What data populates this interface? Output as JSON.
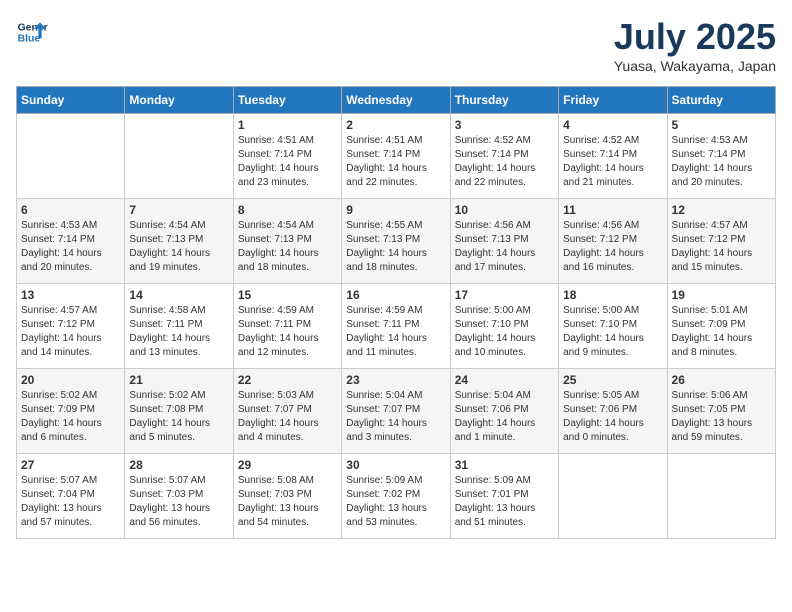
{
  "header": {
    "logo_line1": "General",
    "logo_line2": "Blue",
    "month": "July 2025",
    "location": "Yuasa, Wakayama, Japan"
  },
  "days_of_week": [
    "Sunday",
    "Monday",
    "Tuesday",
    "Wednesday",
    "Thursday",
    "Friday",
    "Saturday"
  ],
  "weeks": [
    [
      {
        "day": "",
        "detail": ""
      },
      {
        "day": "",
        "detail": ""
      },
      {
        "day": "1",
        "detail": "Sunrise: 4:51 AM\nSunset: 7:14 PM\nDaylight: 14 hours\nand 23 minutes."
      },
      {
        "day": "2",
        "detail": "Sunrise: 4:51 AM\nSunset: 7:14 PM\nDaylight: 14 hours\nand 22 minutes."
      },
      {
        "day": "3",
        "detail": "Sunrise: 4:52 AM\nSunset: 7:14 PM\nDaylight: 14 hours\nand 22 minutes."
      },
      {
        "day": "4",
        "detail": "Sunrise: 4:52 AM\nSunset: 7:14 PM\nDaylight: 14 hours\nand 21 minutes."
      },
      {
        "day": "5",
        "detail": "Sunrise: 4:53 AM\nSunset: 7:14 PM\nDaylight: 14 hours\nand 20 minutes."
      }
    ],
    [
      {
        "day": "6",
        "detail": "Sunrise: 4:53 AM\nSunset: 7:14 PM\nDaylight: 14 hours\nand 20 minutes."
      },
      {
        "day": "7",
        "detail": "Sunrise: 4:54 AM\nSunset: 7:13 PM\nDaylight: 14 hours\nand 19 minutes."
      },
      {
        "day": "8",
        "detail": "Sunrise: 4:54 AM\nSunset: 7:13 PM\nDaylight: 14 hours\nand 18 minutes."
      },
      {
        "day": "9",
        "detail": "Sunrise: 4:55 AM\nSunset: 7:13 PM\nDaylight: 14 hours\nand 18 minutes."
      },
      {
        "day": "10",
        "detail": "Sunrise: 4:56 AM\nSunset: 7:13 PM\nDaylight: 14 hours\nand 17 minutes."
      },
      {
        "day": "11",
        "detail": "Sunrise: 4:56 AM\nSunset: 7:12 PM\nDaylight: 14 hours\nand 16 minutes."
      },
      {
        "day": "12",
        "detail": "Sunrise: 4:57 AM\nSunset: 7:12 PM\nDaylight: 14 hours\nand 15 minutes."
      }
    ],
    [
      {
        "day": "13",
        "detail": "Sunrise: 4:57 AM\nSunset: 7:12 PM\nDaylight: 14 hours\nand 14 minutes."
      },
      {
        "day": "14",
        "detail": "Sunrise: 4:58 AM\nSunset: 7:11 PM\nDaylight: 14 hours\nand 13 minutes."
      },
      {
        "day": "15",
        "detail": "Sunrise: 4:59 AM\nSunset: 7:11 PM\nDaylight: 14 hours\nand 12 minutes."
      },
      {
        "day": "16",
        "detail": "Sunrise: 4:59 AM\nSunset: 7:11 PM\nDaylight: 14 hours\nand 11 minutes."
      },
      {
        "day": "17",
        "detail": "Sunrise: 5:00 AM\nSunset: 7:10 PM\nDaylight: 14 hours\nand 10 minutes."
      },
      {
        "day": "18",
        "detail": "Sunrise: 5:00 AM\nSunset: 7:10 PM\nDaylight: 14 hours\nand 9 minutes."
      },
      {
        "day": "19",
        "detail": "Sunrise: 5:01 AM\nSunset: 7:09 PM\nDaylight: 14 hours\nand 8 minutes."
      }
    ],
    [
      {
        "day": "20",
        "detail": "Sunrise: 5:02 AM\nSunset: 7:09 PM\nDaylight: 14 hours\nand 6 minutes."
      },
      {
        "day": "21",
        "detail": "Sunrise: 5:02 AM\nSunset: 7:08 PM\nDaylight: 14 hours\nand 5 minutes."
      },
      {
        "day": "22",
        "detail": "Sunrise: 5:03 AM\nSunset: 7:07 PM\nDaylight: 14 hours\nand 4 minutes."
      },
      {
        "day": "23",
        "detail": "Sunrise: 5:04 AM\nSunset: 7:07 PM\nDaylight: 14 hours\nand 3 minutes."
      },
      {
        "day": "24",
        "detail": "Sunrise: 5:04 AM\nSunset: 7:06 PM\nDaylight: 14 hours\nand 1 minute."
      },
      {
        "day": "25",
        "detail": "Sunrise: 5:05 AM\nSunset: 7:06 PM\nDaylight: 14 hours\nand 0 minutes."
      },
      {
        "day": "26",
        "detail": "Sunrise: 5:06 AM\nSunset: 7:05 PM\nDaylight: 13 hours\nand 59 minutes."
      }
    ],
    [
      {
        "day": "27",
        "detail": "Sunrise: 5:07 AM\nSunset: 7:04 PM\nDaylight: 13 hours\nand 57 minutes."
      },
      {
        "day": "28",
        "detail": "Sunrise: 5:07 AM\nSunset: 7:03 PM\nDaylight: 13 hours\nand 56 minutes."
      },
      {
        "day": "29",
        "detail": "Sunrise: 5:08 AM\nSunset: 7:03 PM\nDaylight: 13 hours\nand 54 minutes."
      },
      {
        "day": "30",
        "detail": "Sunrise: 5:09 AM\nSunset: 7:02 PM\nDaylight: 13 hours\nand 53 minutes."
      },
      {
        "day": "31",
        "detail": "Sunrise: 5:09 AM\nSunset: 7:01 PM\nDaylight: 13 hours\nand 51 minutes."
      },
      {
        "day": "",
        "detail": ""
      },
      {
        "day": "",
        "detail": ""
      }
    ]
  ]
}
